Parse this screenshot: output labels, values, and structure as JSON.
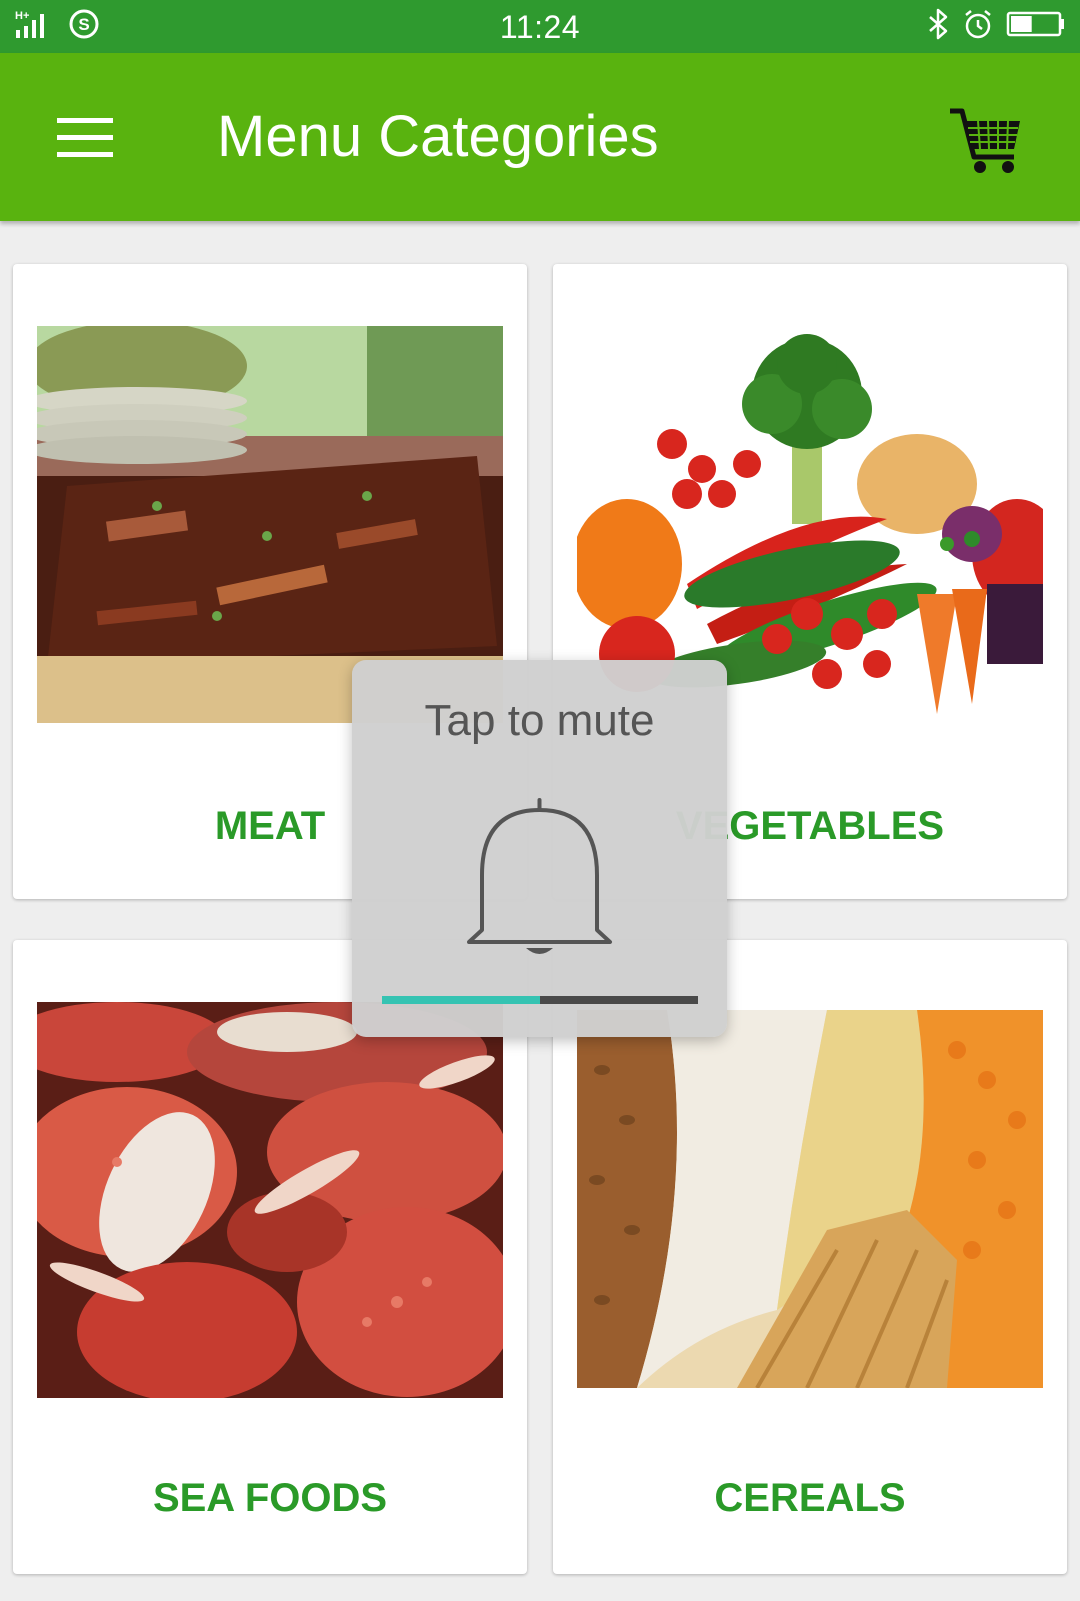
{
  "status_bar": {
    "time": "11:24",
    "network": "H+",
    "battery_level": 0.45
  },
  "app_bar": {
    "title": "Menu Categories"
  },
  "categories": [
    {
      "label": "MEAT"
    },
    {
      "label": "VEGETABLES"
    },
    {
      "label": "SEA FOODS"
    },
    {
      "label": "CEREALS"
    }
  ],
  "volume_popup": {
    "text": "Tap to mute",
    "level": 0.5
  },
  "colors": {
    "status_bar": "#2f9a2f",
    "app_bar": "#59b30f",
    "category_label": "#2a9a28",
    "volume_fill": "#35c3b2"
  }
}
